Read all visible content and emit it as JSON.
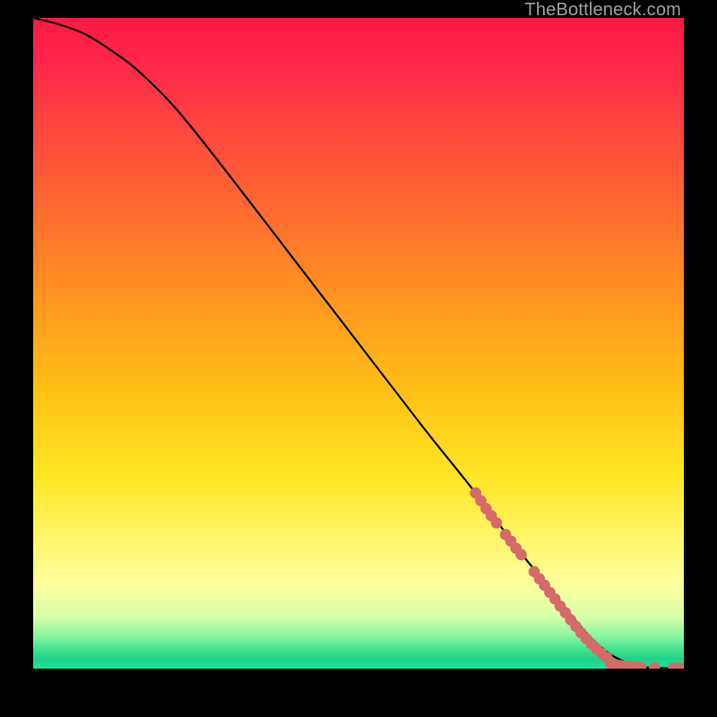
{
  "watermark": "TheBottleneck.com",
  "colors": {
    "curve": "#000000",
    "dots": "#d46a6a",
    "background_black": "#000000"
  },
  "chart_data": {
    "type": "line",
    "title": "",
    "xlabel": "",
    "ylabel": "",
    "xlim": [
      0,
      100
    ],
    "ylim": [
      0,
      100
    ],
    "notes": "Axes are normalized; no tick labels are visible. Curve runs from top-left to a flat floor at bottom-right. Salmon dots highlight the lower segment and the flat tail.",
    "series": [
      {
        "name": "curve",
        "x": [
          0,
          4,
          8,
          12,
          16,
          22,
          30,
          40,
          50,
          60,
          68,
          74,
          78,
          82,
          85,
          87,
          89,
          91,
          92.5,
          94,
          96,
          98,
          100
        ],
        "y": [
          100,
          99,
          97.5,
          95,
          92,
          86,
          76,
          63,
          50,
          37,
          27,
          19,
          14,
          9,
          5.5,
          3.5,
          2,
          1,
          0.5,
          0.2,
          0.1,
          0.05,
          0.05
        ]
      }
    ],
    "highlight_points": {
      "name": "dots",
      "approx": true,
      "points": [
        {
          "x": 68.0,
          "y": 27.0
        },
        {
          "x": 68.8,
          "y": 25.8
        },
        {
          "x": 69.6,
          "y": 24.6
        },
        {
          "x": 70.4,
          "y": 23.5
        },
        {
          "x": 71.2,
          "y": 22.4
        },
        {
          "x": 72.6,
          "y": 20.6
        },
        {
          "x": 73.4,
          "y": 19.6
        },
        {
          "x": 74.2,
          "y": 18.5
        },
        {
          "x": 75.0,
          "y": 17.5
        },
        {
          "x": 77.0,
          "y": 14.9
        },
        {
          "x": 77.8,
          "y": 13.8
        },
        {
          "x": 78.6,
          "y": 12.8
        },
        {
          "x": 79.4,
          "y": 11.7
        },
        {
          "x": 80.2,
          "y": 10.7
        },
        {
          "x": 81.0,
          "y": 9.6
        },
        {
          "x": 81.8,
          "y": 8.6
        },
        {
          "x": 82.6,
          "y": 7.5
        },
        {
          "x": 83.4,
          "y": 6.5
        },
        {
          "x": 84.2,
          "y": 5.5
        },
        {
          "x": 85.0,
          "y": 4.6
        },
        {
          "x": 85.8,
          "y": 3.8
        },
        {
          "x": 86.6,
          "y": 3.0
        },
        {
          "x": 87.4,
          "y": 2.3
        },
        {
          "x": 88.2,
          "y": 1.7
        },
        {
          "x": 88.8,
          "y": 0.8
        },
        {
          "x": 89.5,
          "y": 0.6
        },
        {
          "x": 90.2,
          "y": 0.5
        },
        {
          "x": 91.0,
          "y": 0.4
        },
        {
          "x": 91.8,
          "y": 0.3
        },
        {
          "x": 92.6,
          "y": 0.3
        },
        {
          "x": 93.4,
          "y": 0.2
        },
        {
          "x": 95.5,
          "y": 0.15
        },
        {
          "x": 98.4,
          "y": 0.1
        },
        {
          "x": 99.4,
          "y": 0.1
        }
      ]
    }
  }
}
